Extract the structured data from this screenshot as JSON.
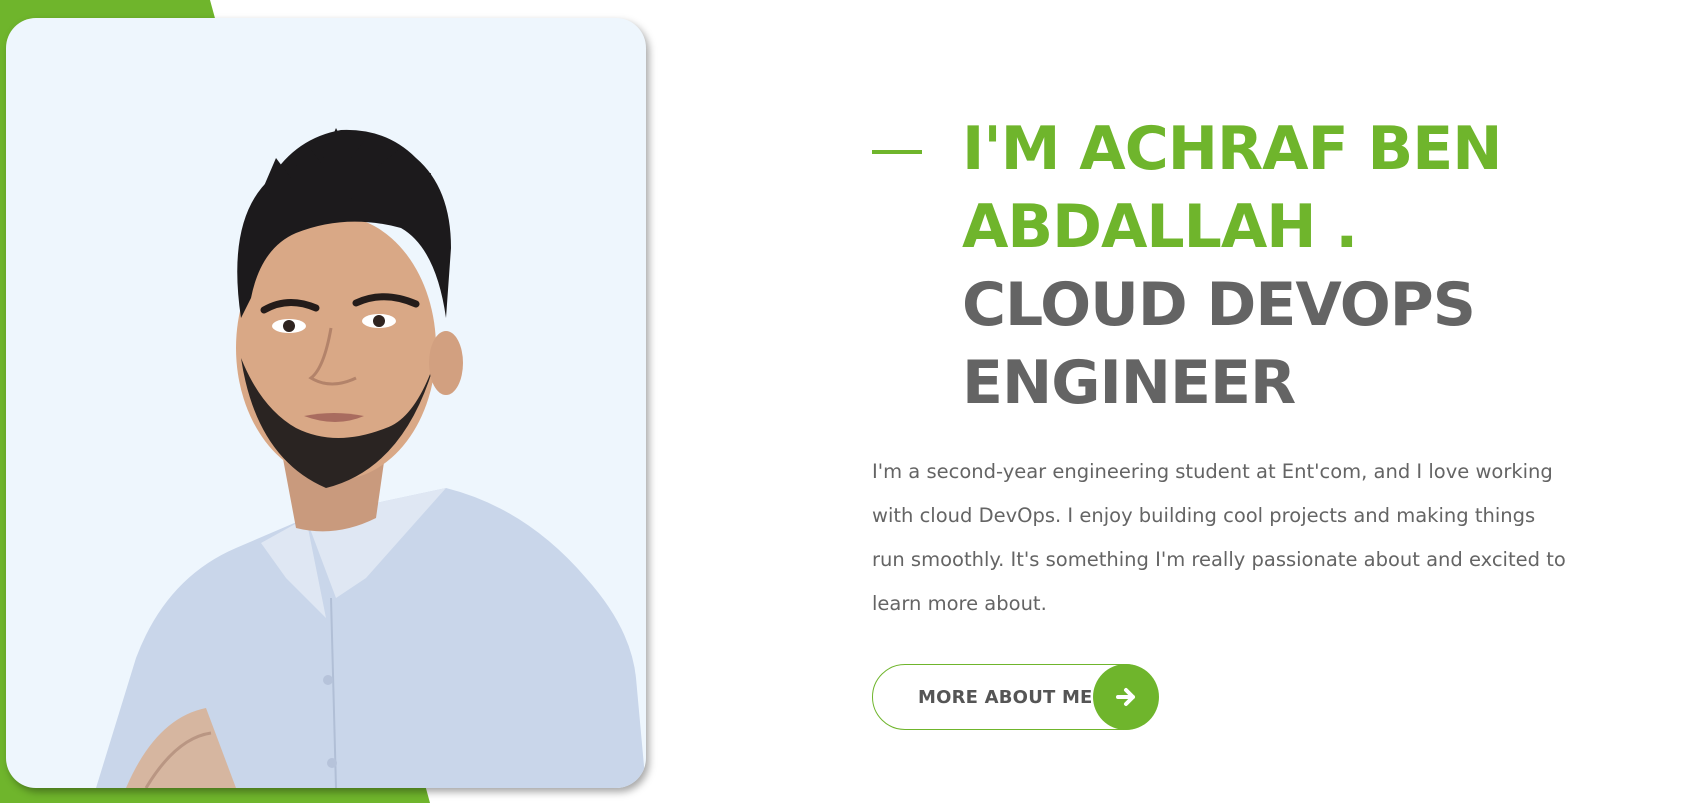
{
  "colors": {
    "accent": "#6fb52c",
    "heading_gray": "#646464",
    "text_gray": "#646464",
    "photo_bg": "#eef6fd"
  },
  "hero": {
    "name_line_1": "I'M ACHRAF BEN",
    "name_line_2": "ABDALLAH .",
    "role_line_1": "CLOUD DEVOPS",
    "role_line_2": "ENGINEER",
    "bio": "I'm a second-year engineering student at Ent'com, and I love working with cloud DevOps. I enjoy building cool projects and making things run smoothly. It's something I'm really passionate about and excited to learn more about.",
    "cta_label": "MORE ABOUT ME",
    "cta_icon": "arrow-right-icon"
  },
  "portrait": {
    "icon": "profile-photo"
  }
}
